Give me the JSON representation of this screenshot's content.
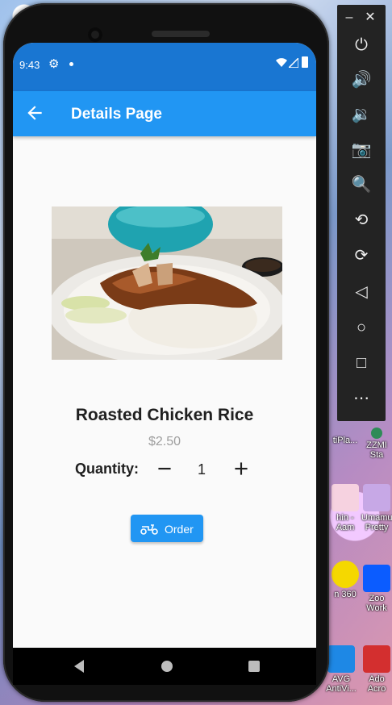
{
  "status_bar": {
    "time": "9:43"
  },
  "app_bar": {
    "title": "Details Page"
  },
  "product": {
    "name": "Roasted Chicken Rice",
    "price": "$2.50"
  },
  "quantity": {
    "label": "Quantity:",
    "value": "1"
  },
  "order_button": {
    "label": "Order"
  },
  "desktop_icons": [
    {
      "label": "tiPla..."
    },
    {
      "label": "ZZMI Sta"
    },
    {
      "label": "hin -Aam"
    },
    {
      "label": "Umamu Pretty"
    },
    {
      "label": "n 360"
    },
    {
      "label": "Zoo Work"
    },
    {
      "label": "AVG AntiVi..."
    },
    {
      "label": "Ado Acro"
    }
  ],
  "colors": {
    "primary": "#2196f3",
    "status_bar": "#1976d2",
    "price_grey": "#9e9e9e"
  }
}
